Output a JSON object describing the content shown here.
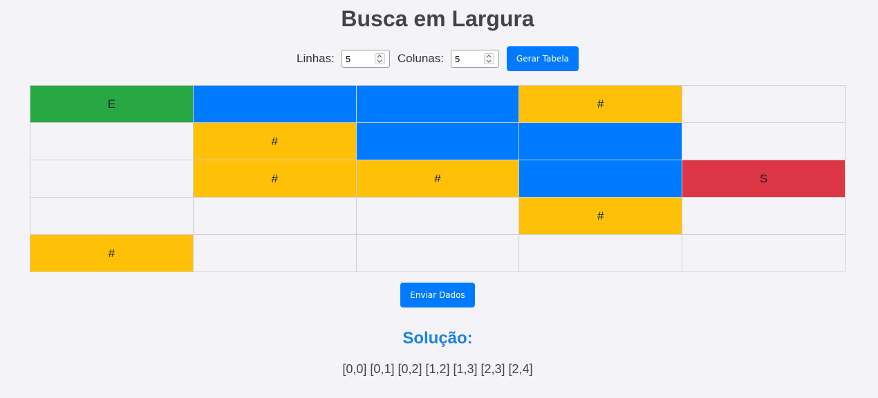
{
  "page": {
    "title": "Busca em Largura"
  },
  "controls": {
    "rows_label": "Linhas:",
    "rows_value": "5",
    "cols_label": "Colunas:",
    "cols_value": "5",
    "generate_label": "Gerar Tabela"
  },
  "grid": {
    "rows": [
      [
        {
          "text": "E",
          "type": "start"
        },
        {
          "text": "",
          "type": "path"
        },
        {
          "text": "",
          "type": "path"
        },
        {
          "text": "#",
          "type": "wall"
        },
        {
          "text": "",
          "type": "empty"
        }
      ],
      [
        {
          "text": "",
          "type": "empty"
        },
        {
          "text": "#",
          "type": "wall"
        },
        {
          "text": "",
          "type": "path"
        },
        {
          "text": "",
          "type": "path"
        },
        {
          "text": "",
          "type": "empty"
        }
      ],
      [
        {
          "text": "",
          "type": "empty"
        },
        {
          "text": "#",
          "type": "wall"
        },
        {
          "text": "#",
          "type": "wall"
        },
        {
          "text": "",
          "type": "path"
        },
        {
          "text": "S",
          "type": "end"
        }
      ],
      [
        {
          "text": "",
          "type": "empty"
        },
        {
          "text": "",
          "type": "empty"
        },
        {
          "text": "",
          "type": "empty"
        },
        {
          "text": "#",
          "type": "wall"
        },
        {
          "text": "",
          "type": "empty"
        }
      ],
      [
        {
          "text": "#",
          "type": "wall"
        },
        {
          "text": "",
          "type": "empty"
        },
        {
          "text": "",
          "type": "empty"
        },
        {
          "text": "",
          "type": "empty"
        },
        {
          "text": "",
          "type": "empty"
        }
      ]
    ]
  },
  "actions": {
    "submit_label": "Enviar Dados"
  },
  "solution": {
    "title": "Solução:",
    "path_text": "[0,0] [0,1] [0,2] [1,2] [1,3] [2,3] [2,4]"
  },
  "colors": {
    "start": "#28a745",
    "end": "#dc3545",
    "wall": "#ffc107",
    "path": "#007bff",
    "button": "#007bff",
    "solution_title": "#1a82e2"
  }
}
